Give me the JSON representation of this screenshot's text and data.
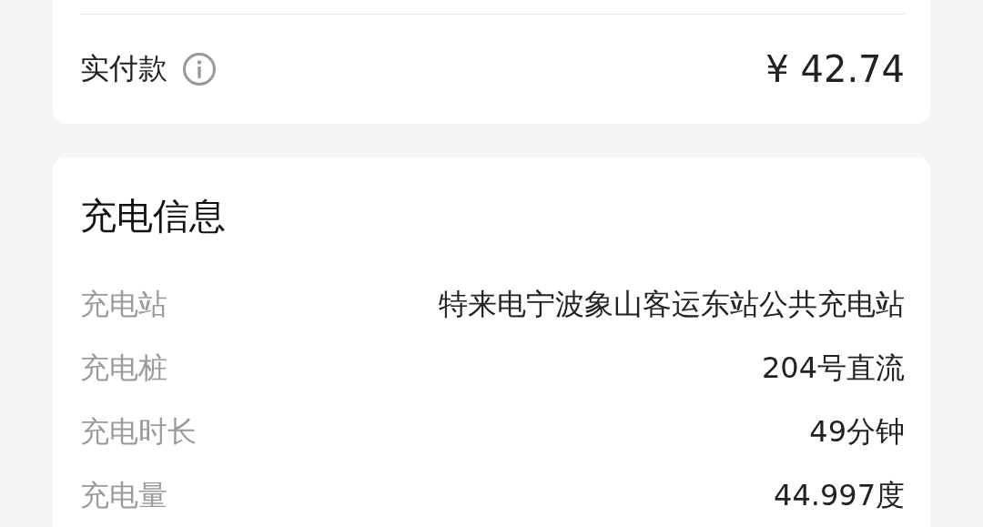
{
  "payment": {
    "label": "实付款",
    "amount": "¥ 42.74"
  },
  "charging_info": {
    "title": "充电信息",
    "rows": [
      {
        "label": "充电站",
        "value": "特来电宁波象山客运东站公共充电站"
      },
      {
        "label": "充电桩",
        "value": "204号直流"
      },
      {
        "label": "充电时长",
        "value": "49分钟"
      },
      {
        "label": "充电量",
        "value": "44.997度"
      }
    ]
  }
}
